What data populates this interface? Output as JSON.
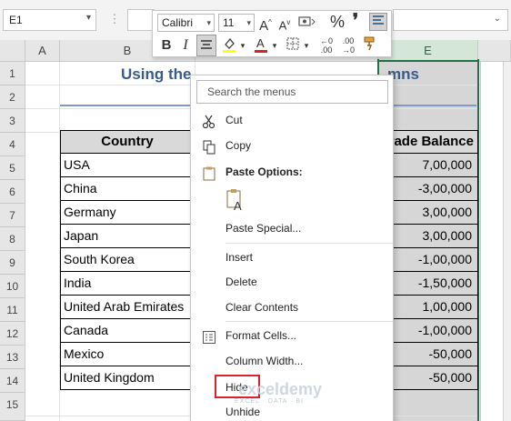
{
  "formula_bar": {
    "name_box": "E1",
    "formula": ""
  },
  "mini_toolbar": {
    "font_name": "Calibri",
    "font_size": "11",
    "highlight_color": "#ffff00",
    "font_color": "#e02020"
  },
  "columns": [
    "A",
    "B",
    "E"
  ],
  "rows": [
    "1",
    "2",
    "3",
    "4",
    "5",
    "6",
    "7",
    "8",
    "9",
    "10",
    "11",
    "12",
    "13",
    "14",
    "15"
  ],
  "sheet": {
    "title_left": "Using the",
    "title_right": "mns",
    "header_country": "Country",
    "header_balance": "rade Balance",
    "countries": [
      "USA",
      "China",
      "Germany",
      "Japan",
      "South Korea",
      "India",
      "United Arab Emirates",
      "Canada",
      "Mexico",
      "United Kingdom"
    ],
    "balances": [
      "7,00,000",
      "-3,00,000",
      "3,00,000",
      "3,00,000",
      "-1,00,000",
      "-1,50,000",
      "1,00,000",
      "-1,00,000",
      "-50,000",
      "-50,000"
    ]
  },
  "context_menu": {
    "search_placeholder": "Search the menus",
    "cut": "Cut",
    "copy": "Copy",
    "paste_options": "Paste Options:",
    "paste_special": "Paste Special...",
    "insert": "Insert",
    "delete": "Delete",
    "clear_contents": "Clear Contents",
    "format_cells": "Format Cells...",
    "column_width": "Column Width...",
    "hide": "Hide",
    "unhide": "Unhide"
  },
  "watermark": {
    "brand": "exceldemy",
    "tagline": "EXCEL · DATA · BI"
  },
  "colors": {
    "accent": "#217346",
    "highlight_box": "#d9232d",
    "title": "#3b5a86"
  }
}
